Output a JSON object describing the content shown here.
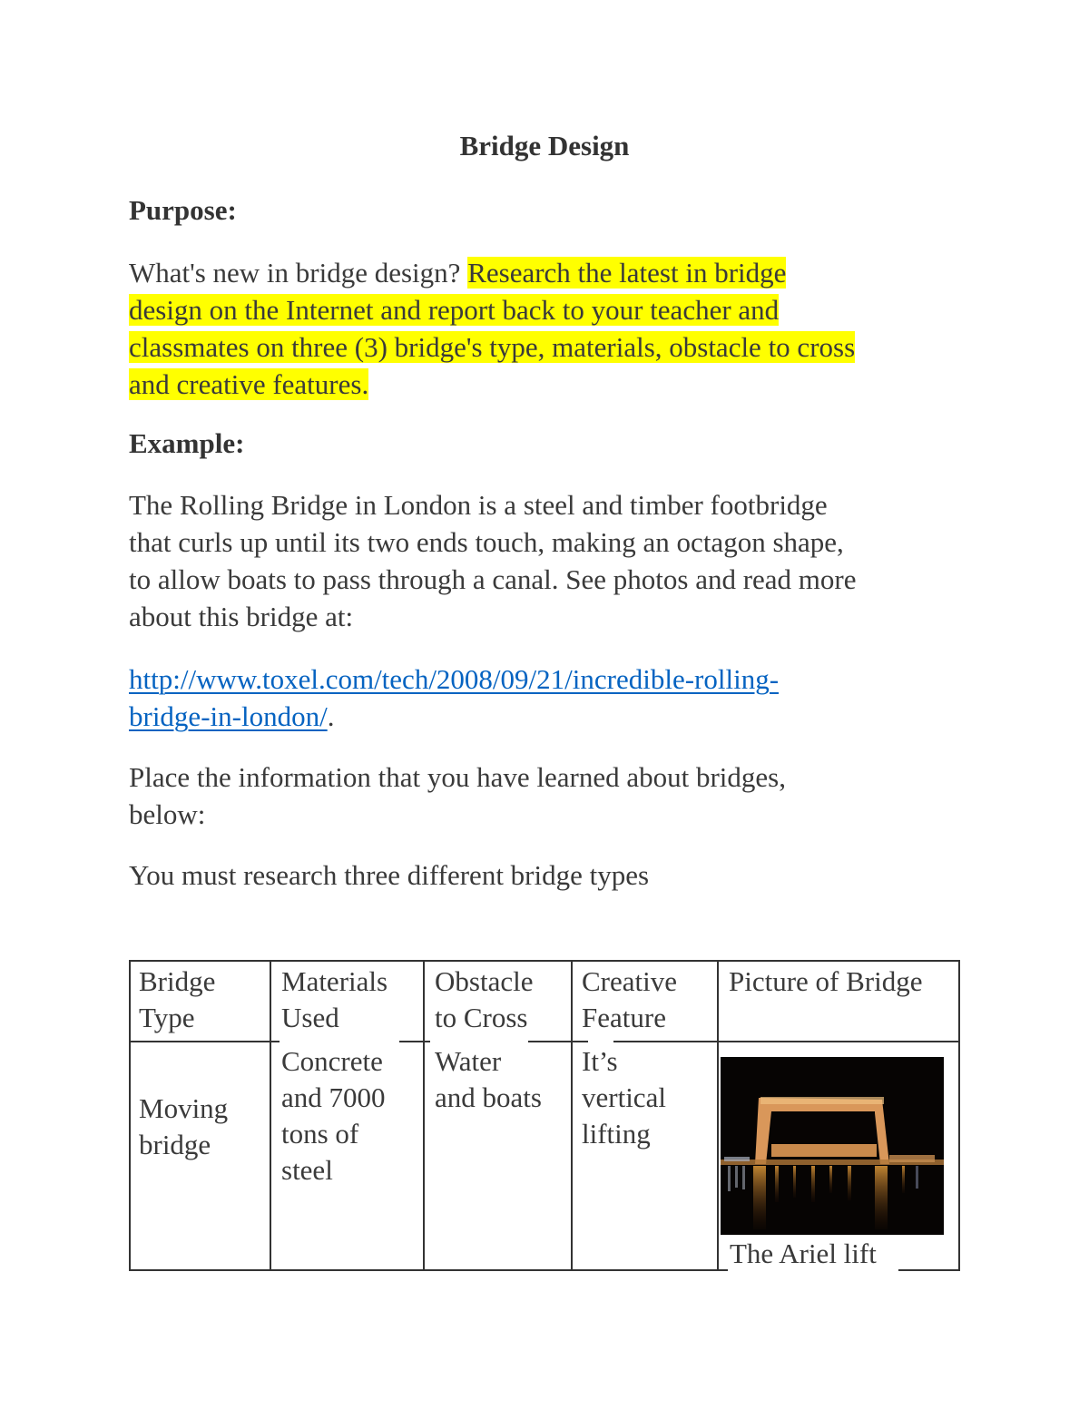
{
  "document": {
    "title": "Bridge Design",
    "purpose_heading": "Purpose:",
    "purpose_text_plain": "What's new in bridge design? ",
    "purpose_text_highlighted": {
      "line1": "Research the latest in bridge",
      "line2": "design on the Internet and report back to your teacher and",
      "line3": "classmates on three (3) bridge's type, materials, obstacle to cross",
      "line4": "and creative features."
    },
    "highlight_color": "#ffff00",
    "example_heading": "Example:",
    "example_text": {
      "line1": "The Rolling Bridge in London is a steel and timber footbridge",
      "line2": "that curls up until its two ends touch, making an octagon shape,",
      "line3": "to allow boats to pass through a canal. See photos and read more",
      "line4": "about this bridge at:"
    },
    "link": {
      "line1": "http://www.toxel.com/tech/2008/09/21/incredible-rolling-",
      "line2": "bridge-in-london/",
      "trailing": ".",
      "color": "#0563c1"
    },
    "instruction": {
      "line1": "Place the information that you have learned about bridges,",
      "line2": "below:"
    },
    "requirement": "You must research three different bridge types"
  },
  "table": {
    "headers": [
      {
        "line1": "Bridge",
        "line2": "Type"
      },
      {
        "line1": "Materials",
        "line2": "Used"
      },
      {
        "line1": "Obstacle",
        "line2": "to Cross"
      },
      {
        "line1": "Creative",
        "line2": "Feature"
      },
      {
        "line1": "Picture of Bridge",
        "line2": ""
      }
    ],
    "rows": [
      {
        "bridge_type": {
          "line1": "Moving",
          "line2": "bridge"
        },
        "materials": {
          "line1": "Concrete",
          "line2": "and 7000",
          "line3": "tons of",
          "line4": "steel"
        },
        "obstacle": {
          "line1": "Water",
          "line2": "and boats"
        },
        "creative_feature": {
          "line1": "It’s",
          "line2": "vertical",
          "line3": "lifting"
        },
        "picture": {
          "icon": "bridge-night-photo",
          "caption": "The Ariel lift"
        }
      }
    ]
  }
}
